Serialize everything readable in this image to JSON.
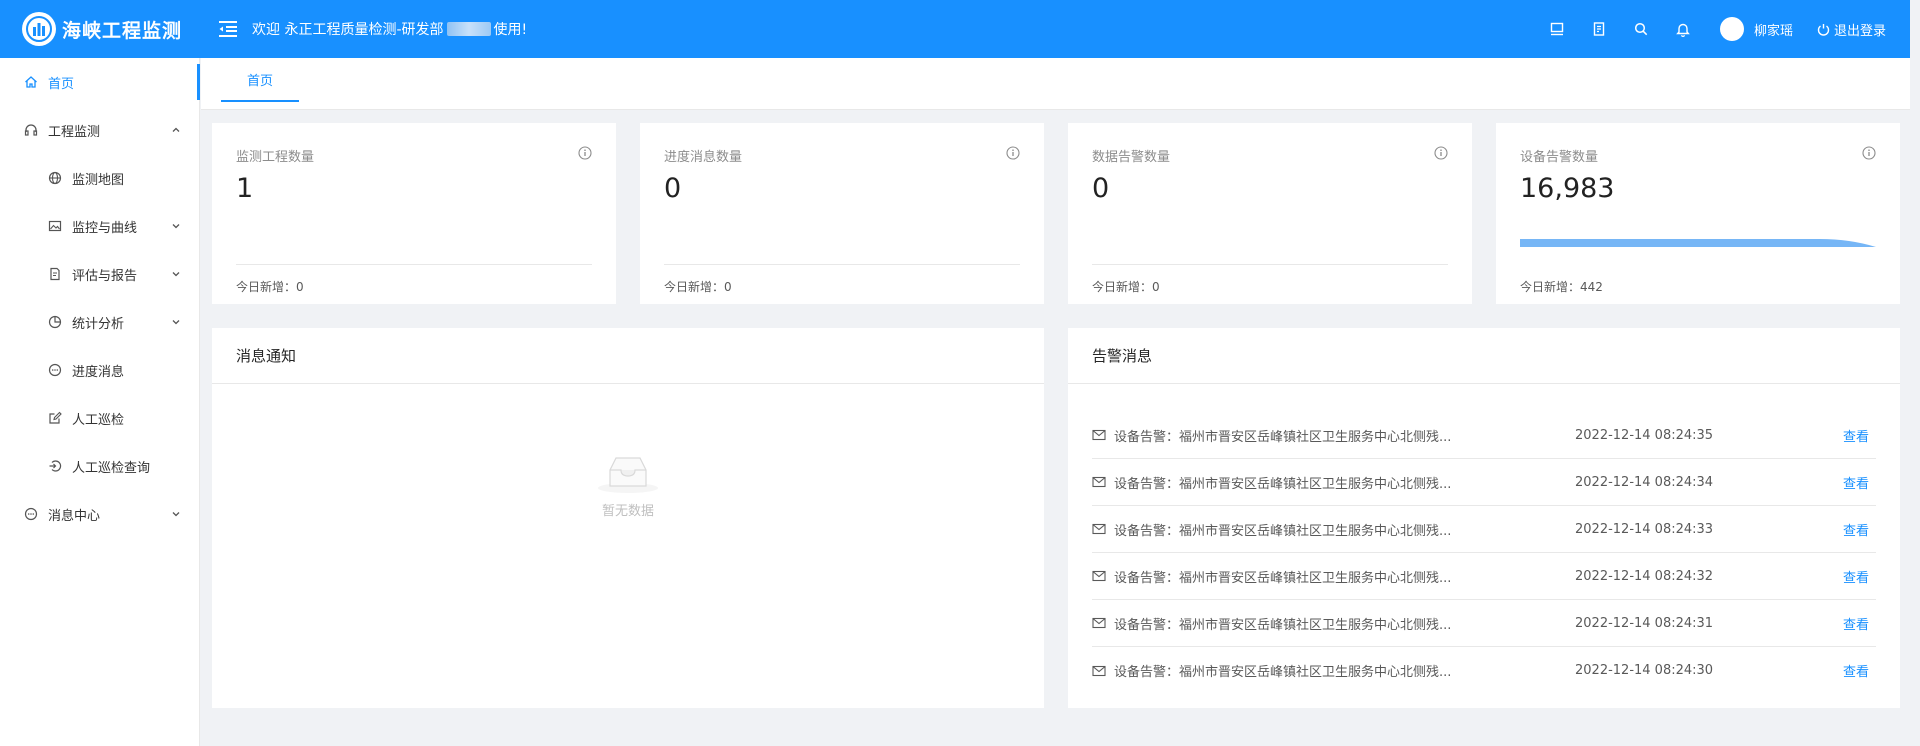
{
  "header": {
    "logo_text": "海峡工程监测",
    "welcome_prefix": "欢迎 永正工程质量检测-研发部",
    "welcome_suffix": "使用!",
    "username": "柳家瑶",
    "logout_label": "退出登录"
  },
  "sidebar": {
    "items": [
      {
        "label": "首页"
      },
      {
        "label": "工程监测"
      },
      {
        "label": "监测地图"
      },
      {
        "label": "监控与曲线"
      },
      {
        "label": "评估与报告"
      },
      {
        "label": "统计分析"
      },
      {
        "label": "进度消息"
      },
      {
        "label": "人工巡检"
      },
      {
        "label": "人工巡检查询"
      },
      {
        "label": "消息中心"
      }
    ]
  },
  "tabs": [
    {
      "label": "首页"
    }
  ],
  "stats": [
    {
      "title": "监测工程数量",
      "value": "1",
      "foot": "今日新增：0"
    },
    {
      "title": "进度消息数量",
      "value": "0",
      "foot": "今日新增：0"
    },
    {
      "title": "数据告警数量",
      "value": "0",
      "foot": "今日新增：0"
    },
    {
      "title": "设备告警数量",
      "value": "16,983",
      "foot": "今日新增：442"
    }
  ],
  "notice_panel": {
    "title": "消息通知",
    "empty_text": "暂无数据"
  },
  "alarm_panel": {
    "title": "告警消息",
    "view_label": "查看",
    "rows": [
      {
        "text": "设备告警：福州市晋安区岳峰镇社区卫生服务中心北侧残...",
        "time": "2022-12-14 08:24:35"
      },
      {
        "text": "设备告警：福州市晋安区岳峰镇社区卫生服务中心北侧残...",
        "time": "2022-12-14 08:24:34"
      },
      {
        "text": "设备告警：福州市晋安区岳峰镇社区卫生服务中心北侧残...",
        "time": "2022-12-14 08:24:33"
      },
      {
        "text": "设备告警：福州市晋安区岳峰镇社区卫生服务中心北侧残...",
        "time": "2022-12-14 08:24:32"
      },
      {
        "text": "设备告警：福州市晋安区岳峰镇社区卫生服务中心北侧残...",
        "time": "2022-12-14 08:24:31"
      },
      {
        "text": "设备告警：福州市晋安区岳峰镇社区卫生服务中心北侧残...",
        "time": "2022-12-14 08:24:30"
      }
    ]
  },
  "colors": {
    "primary": "#1890ff",
    "background": "#f0f2f5",
    "trend_fill": "#5ea9f5"
  }
}
